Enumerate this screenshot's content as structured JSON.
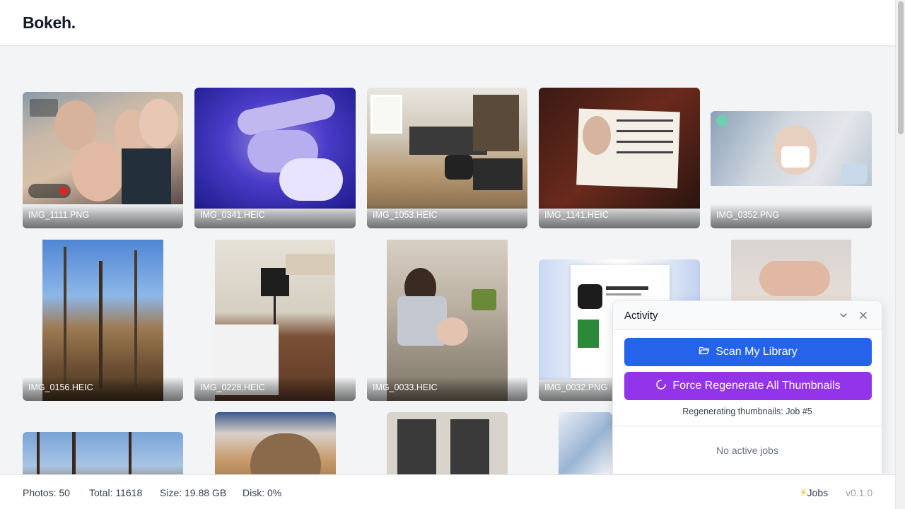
{
  "app": {
    "title": "Bokeh."
  },
  "photos": [
    {
      "name": "IMG_1111.PNG"
    },
    {
      "name": "IMG_0341.HEIC"
    },
    {
      "name": "IMG_1053.HEIC"
    },
    {
      "name": "IMG_1141.HEIC"
    },
    {
      "name": "IMG_0352.PNG"
    },
    {
      "name": "IMG_0156.HEIC"
    },
    {
      "name": "IMG_0228.HEIC"
    },
    {
      "name": "IMG_0033.HEIC"
    },
    {
      "name": "IMG_0032.PNG"
    }
  ],
  "activity": {
    "title": "Activity",
    "scan_label": "Scan My Library",
    "regen_label": "Force Regenerate All Thumbnails",
    "status": "Regenerating thumbnails: Job #5",
    "empty": "No active jobs",
    "icons": [
      "chevron-down-icon",
      "close-icon",
      "folder-open-icon",
      "spinner-icon"
    ]
  },
  "footer": {
    "photos": "Photos: 50",
    "total": "Total: 11618",
    "size": "Size: 19.88 GB",
    "disk": "Disk: 0%",
    "jobs": "Jobs",
    "version": "v0.1.0"
  },
  "colors": {
    "primary": "#2563eb",
    "secondary": "#9333ea",
    "jobs_icon": "#eab308"
  }
}
